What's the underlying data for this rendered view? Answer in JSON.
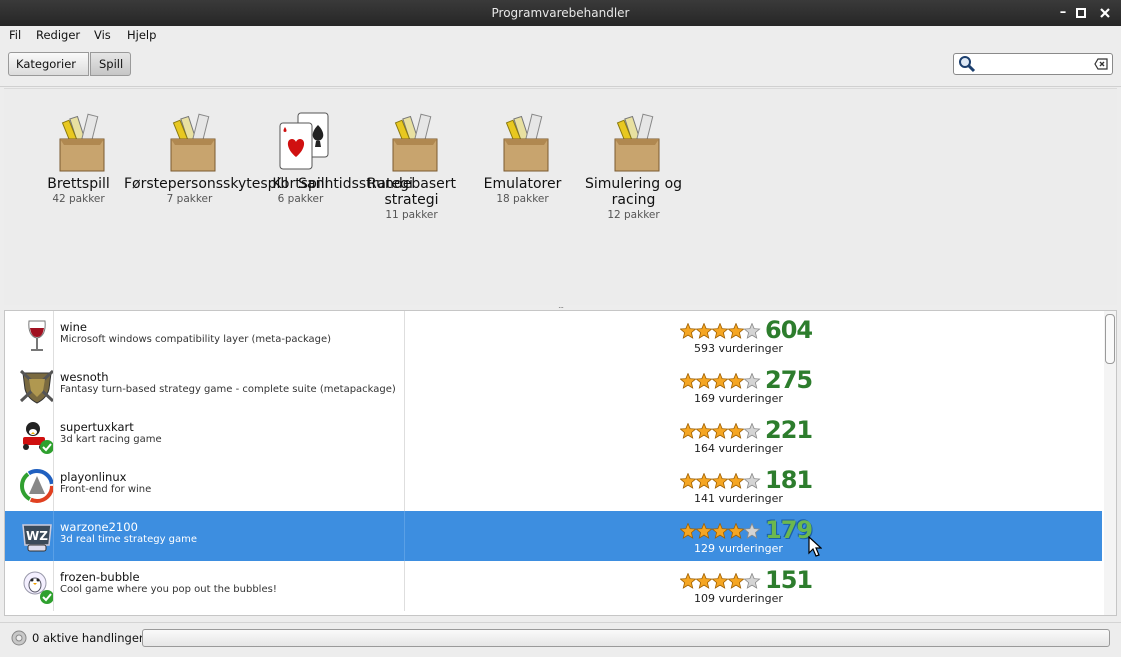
{
  "window": {
    "title": "Programvarebehandler"
  },
  "menu": [
    "Fil",
    "Rediger",
    "Vis",
    "Hjelp"
  ],
  "breadcrumb": [
    "Kategorier",
    "Spill"
  ],
  "search": {
    "value": "",
    "placeholder": ""
  },
  "categories": [
    {
      "name": "Brettspill",
      "count": "42 pakker",
      "icon": "game-box-icon"
    },
    {
      "name": "Førstepersonsskytespill",
      "count": "7 pakker",
      "icon": "game-box-icon"
    },
    {
      "name": "Kortspill",
      "count": "6 pakker",
      "icon": "playing-cards-icon"
    },
    {
      "name": "Sanntidsstrategi",
      "count": "",
      "icon": ""
    },
    {
      "name": "Rundebasert strategi",
      "count": "11 pakker",
      "icon": "game-box-icon"
    },
    {
      "name": "Emulatorer",
      "count": "18 pakker",
      "icon": "game-box-icon"
    },
    {
      "name": "Simulering og racing",
      "count": "12 pakker",
      "icon": "game-box-icon"
    }
  ],
  "packages": [
    {
      "name": "wine",
      "desc": "Microsoft windows compatibility layer (meta-package)",
      "score": "604",
      "votes": "593 vurderinger",
      "rating": 4,
      "icon": "wine-glass-icon",
      "selected": false
    },
    {
      "name": "wesnoth",
      "desc": "Fantasy turn-based strategy game - complete suite (metapackage)",
      "score": "275",
      "votes": "169 vurderinger",
      "rating": 4,
      "icon": "shield-icon",
      "selected": false
    },
    {
      "name": "supertuxkart",
      "desc": "3d kart racing game",
      "score": "221",
      "votes": "164 vurderinger",
      "rating": 4,
      "icon": "kart-icon",
      "selected": false
    },
    {
      "name": "playonlinux",
      "desc": "Front-end for wine",
      "score": "181",
      "votes": "141 vurderinger",
      "rating": 4,
      "icon": "playonlinux-icon",
      "selected": false
    },
    {
      "name": "warzone2100",
      "desc": "3d real time strategy game",
      "score": "179",
      "votes": "129 vurderinger",
      "rating": 4,
      "icon": "warzone-icon",
      "selected": true
    },
    {
      "name": "frozen-bubble",
      "desc": "Cool game where you pop out the bubbles!",
      "score": "151",
      "votes": "109 vurderinger",
      "rating": 4,
      "icon": "penguin-icon",
      "selected": false
    }
  ],
  "status": {
    "text": "0 aktive handlinger"
  },
  "colors": {
    "selection": "#3d8ee0",
    "score": "#2d7d2d",
    "star": "#f5a623"
  }
}
